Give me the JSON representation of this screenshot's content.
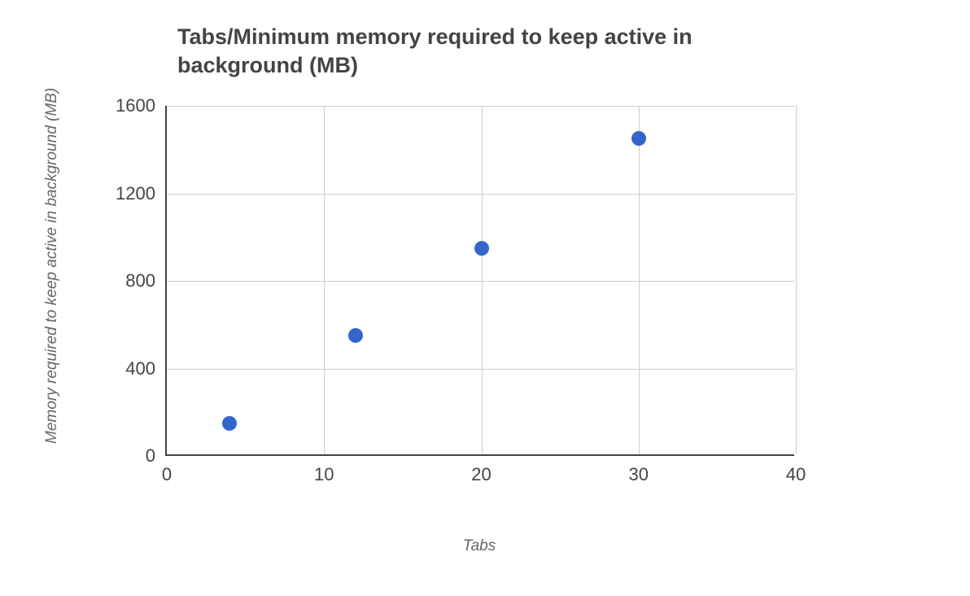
{
  "chart_data": {
    "type": "scatter",
    "title": "Tabs/Minimum memory required to keep active in background (MB)",
    "xlabel": "Tabs",
    "ylabel": "Memory required to keep active in background (MB)",
    "xlim": [
      0,
      40
    ],
    "ylim": [
      0,
      1600
    ],
    "x_ticks": [
      0,
      10,
      20,
      30,
      40
    ],
    "y_ticks": [
      0,
      400,
      800,
      1200,
      1600
    ],
    "x": [
      4,
      12,
      20,
      30
    ],
    "y": [
      150,
      550,
      950,
      1450
    ],
    "point_color": "#3366cc"
  }
}
